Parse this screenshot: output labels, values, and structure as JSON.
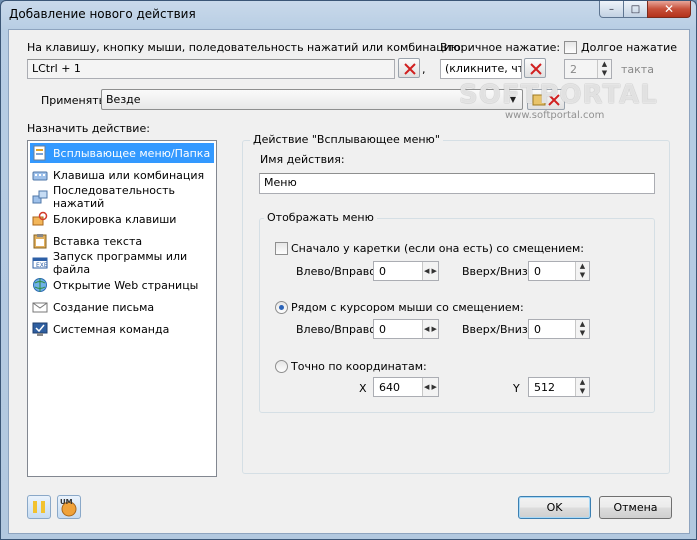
{
  "window": {
    "title": "Добавление нового действия",
    "minimize": "–",
    "maximize": "□",
    "close": "✕"
  },
  "hotkey": {
    "label": "На клавишу, кнопку мыши, поледовательность нажатий или комбинацию:",
    "value": "LCtrl + 1",
    "separator": ","
  },
  "secondary": {
    "label": "Вторичное нажатие:",
    "value": "(кликните, что",
    "long_press_label": "Долгое нажатие",
    "long_press_checked": false,
    "tact_value": "2",
    "tact_label": "такта"
  },
  "apply": {
    "label": "Применять",
    "value": "Везде"
  },
  "watermark": {
    "text": "SOFTPORTAL",
    "url": "www.softportal.com"
  },
  "assign": {
    "label": "Назначить действие:",
    "items": [
      {
        "label": "Всплывающее меню/Папка",
        "icon": "popup-menu-icon",
        "selected": true
      },
      {
        "label": "Клавиша или комбинация",
        "icon": "keyboard-icon",
        "selected": false
      },
      {
        "label": "Последовательность нажатий",
        "icon": "key-sequence-icon",
        "selected": false
      },
      {
        "label": "Блокировка клавиши",
        "icon": "lock-key-icon",
        "selected": false
      },
      {
        "label": "Вставка текста",
        "icon": "paste-text-icon",
        "selected": false
      },
      {
        "label": "Запуск программы или файла",
        "icon": "run-program-icon",
        "selected": false
      },
      {
        "label": "Открытие Web страницы",
        "icon": "web-page-icon",
        "selected": false
      },
      {
        "label": "Создание письма",
        "icon": "mail-icon",
        "selected": false
      },
      {
        "label": "Системная команда",
        "icon": "system-command-icon",
        "selected": false
      }
    ]
  },
  "action": {
    "group_title": "Действие \"Всплывающее меню\"",
    "name_label": "Имя действия:",
    "name_value": "Меню",
    "show_menu_title": "Отображать меню",
    "option_caret": {
      "label": "Сначало у каретки (если она есть) со смещением:",
      "checked": false,
      "lr_label": "Влево/Вправо",
      "lr_value": "0",
      "ud_label": "Вверх/Вниз",
      "ud_value": "0"
    },
    "option_mouse": {
      "label": "Рядом с курсором мыши со смещением:",
      "checked": true,
      "lr_label": "Влево/Вправо",
      "lr_value": "0",
      "ud_label": "Вверх/Вниз",
      "ud_value": "0"
    },
    "option_coords": {
      "label": "Точно по координатам:",
      "checked": false,
      "x_label": "X",
      "x_value": "640",
      "y_label": "Y",
      "y_value": "512"
    }
  },
  "footer": {
    "ok": "OK",
    "cancel": "Отмена",
    "um_label": "UM"
  },
  "colors": {
    "selection": "#3399ff",
    "accent_blue": "#2a63b8"
  }
}
